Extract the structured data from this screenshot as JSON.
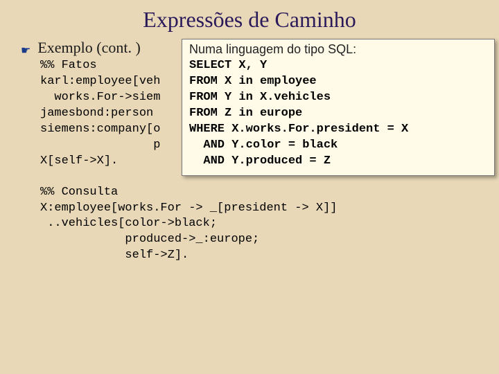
{
  "title": "Expressões de Caminho",
  "exemplo_label": "Exemplo (cont. )",
  "facts": "%% Fatos\nkarl:employee[veh\n  works.For->siem\njamesbond:person\nsiemens:company[o\n                p\nX[self->X].",
  "consulta": "%% Consulta\nX:employee[works.For -> _[president -> X]]\n ..vehicles[color->black;\n            produced->_:europe;\n            self->Z].",
  "sql_heading": "Numa linguagem do tipo SQL:",
  "sql_code": "SELECT X, Y\nFROM X in employee\nFROM Y in X.vehicles\nFROM Z in europe\nWHERE X.works.For.president = X\n  AND Y.color = black\n  AND Y.produced = Z"
}
